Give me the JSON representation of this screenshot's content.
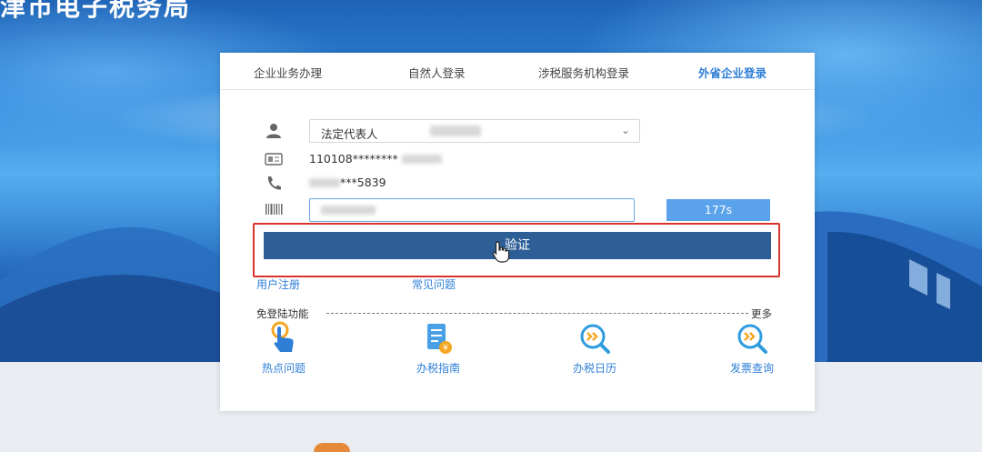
{
  "site": {
    "title": "津市电子税务局"
  },
  "tabs": [
    {
      "label": "企业业务办理",
      "active": false
    },
    {
      "label": "自然人登录",
      "active": false
    },
    {
      "label": "涉税服务机构登录",
      "active": false
    },
    {
      "label": "外省企业登录",
      "active": true
    }
  ],
  "form": {
    "role_select": {
      "value": "法定代表人",
      "icon": "user-icon"
    },
    "id_number": {
      "value": "110108********",
      "icon": "id-card-icon"
    },
    "phone": {
      "value": "***5839",
      "icon": "phone-icon"
    },
    "code_input": {
      "icon": "barcode-icon"
    },
    "countdown": "177s",
    "verify_button": "验证"
  },
  "links": {
    "register": "用户注册",
    "faq": "常见问题"
  },
  "quick_functions": {
    "title": "免登陆功能",
    "more": "更多",
    "items": [
      {
        "label": "热点问题",
        "icon": "tap-hand-icon"
      },
      {
        "label": "办税指南",
        "icon": "guide-document-icon"
      },
      {
        "label": "办税日历",
        "icon": "calendar-search-icon"
      },
      {
        "label": "发票查询",
        "icon": "invoice-search-icon"
      }
    ]
  },
  "colors": {
    "accent": "#2f7fd6",
    "verify_button": "#2d5f96",
    "countdown": "#5aa3ea",
    "highlight_border": "#d9342b",
    "icon_orange": "#f5a623"
  }
}
